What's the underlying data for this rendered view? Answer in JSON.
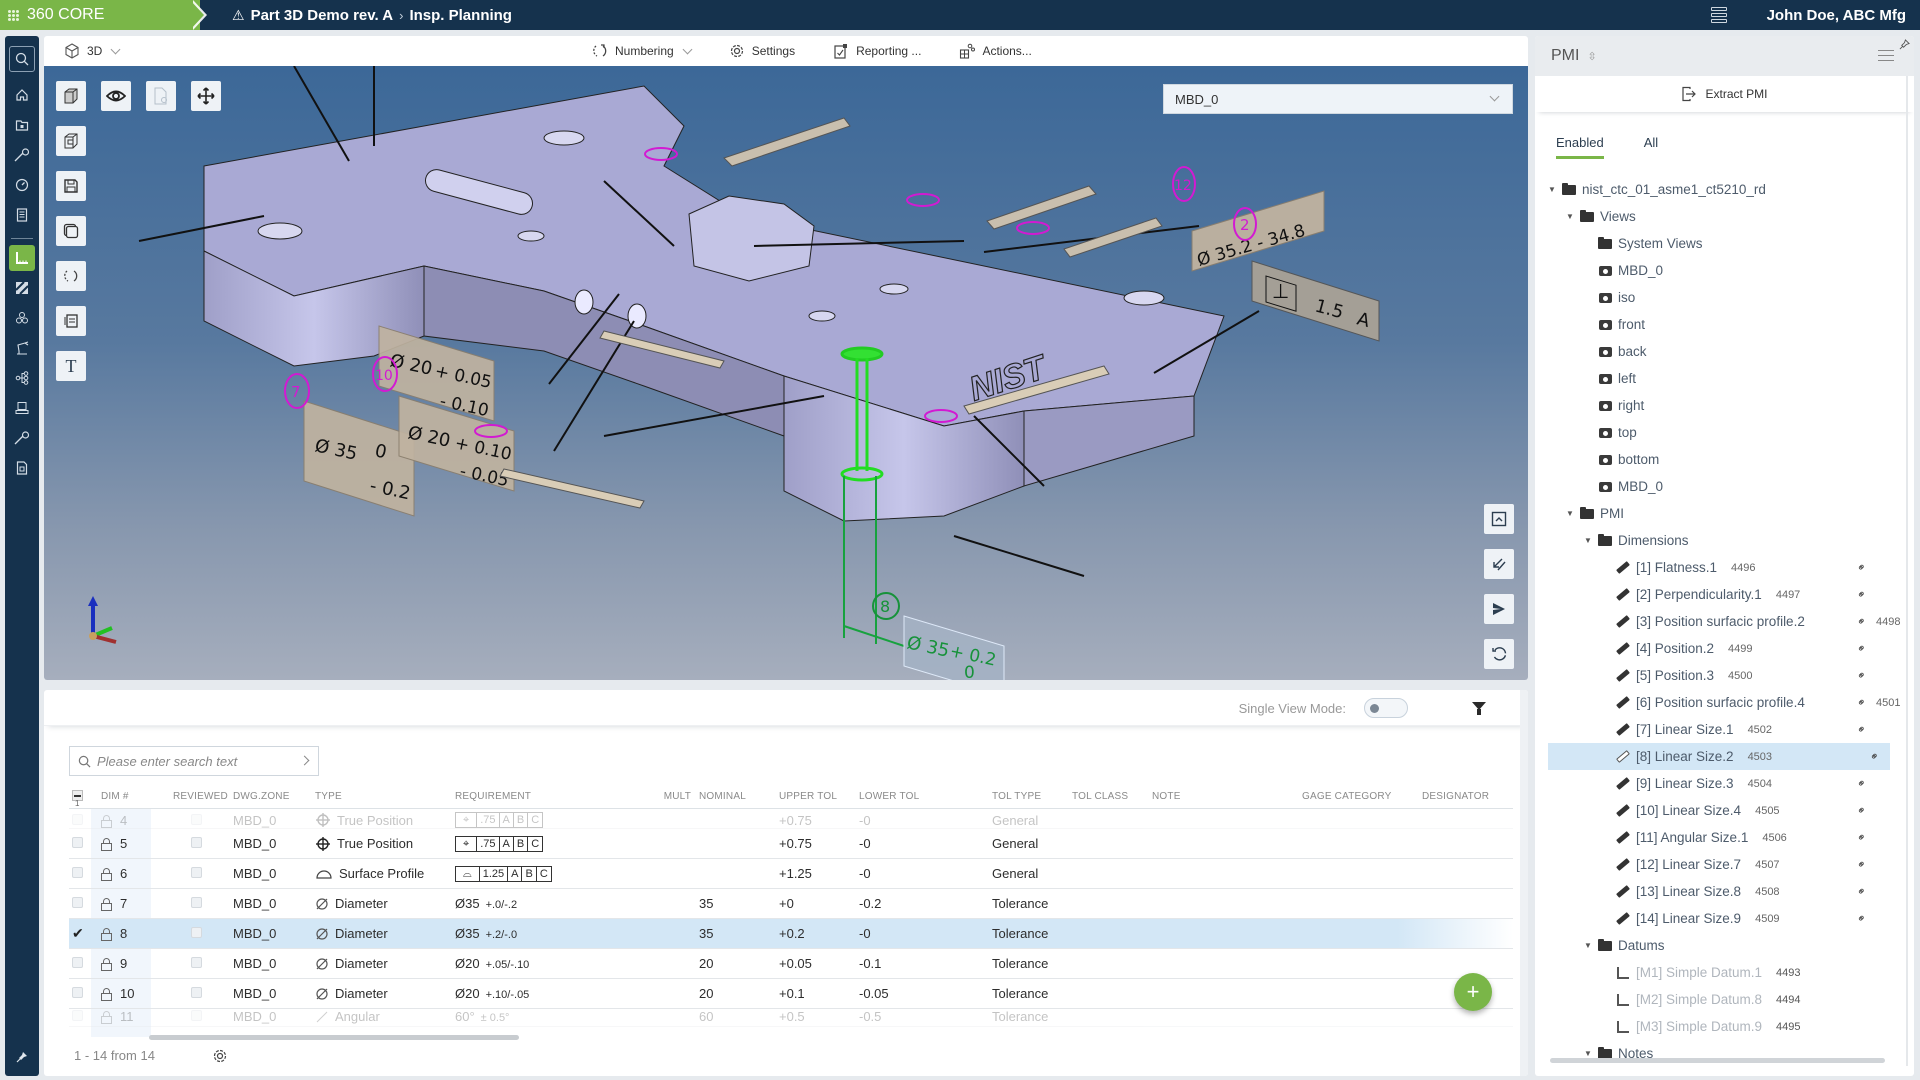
{
  "header": {
    "brand": "360 CORE",
    "part_title": "Part 3D Demo rev. A",
    "crumb_separator": "›",
    "section": "Insp. Planning",
    "user": "John Doe, ABC Mfg",
    "brand_color": "#7ab648",
    "bar_color": "#15324d"
  },
  "rail": {
    "items": [
      {
        "name": "search",
        "icon": "search-icon"
      },
      {
        "name": "home",
        "icon": "home-icon"
      },
      {
        "name": "parts-folder",
        "icon": "folder-icon"
      },
      {
        "name": "measure",
        "icon": "caliper-icon"
      },
      {
        "name": "dashboard",
        "icon": "gauge-icon"
      },
      {
        "name": "documents",
        "icon": "document-icon"
      },
      {
        "name": "inspection-planning",
        "icon": "ruler-icon",
        "active": true
      },
      {
        "name": "materials",
        "icon": "hatch-icon"
      },
      {
        "name": "resources",
        "icon": "cluster-icon"
      },
      {
        "name": "robot",
        "icon": "robot-arm-icon"
      },
      {
        "name": "workflow",
        "icon": "network-icon"
      },
      {
        "name": "machines",
        "icon": "machine-icon"
      },
      {
        "name": "gauges",
        "icon": "caliper-icon"
      },
      {
        "name": "reports",
        "icon": "report-icon"
      }
    ]
  },
  "viewer": {
    "mode_label": "3D",
    "toolbar": {
      "numbering": "Numbering",
      "settings": "Settings",
      "reporting": "Reporting ...",
      "actions": "Actions..."
    },
    "view_select": "MBD_0",
    "annotations": {
      "dim7_a": "Ø 35",
      "dim7_b": "0",
      "dim7_c": "- 0.2",
      "dim10_a": "Ø 20",
      "dim10_b": "+ 0.05",
      "dim10_c": "- 0.10",
      "dim9_a": "Ø 20",
      "dim9_b": "+ 0.10",
      "dim9_c": "- 0.05",
      "dim12": "Ø 35.2 - 34.8",
      "perp_val": "1.5",
      "perp_datum": "A",
      "dim8_a": "Ø 35",
      "dim8_b": "+ 0.2",
      "dim8_c": "0",
      "balloon_7": "7",
      "balloon_10": "10",
      "balloon_12": "12",
      "balloon_2": "2",
      "balloon_8": "8",
      "logo": "NIST"
    }
  },
  "table": {
    "single_view_label": "Single View Mode:",
    "single_view_on": false,
    "search_placeholder": "Please enter search text",
    "select_all_count": "1",
    "columns": [
      "DIM #",
      "REVIEWED",
      "DWG.ZONE",
      "TYPE",
      "REQUIREMENT",
      "MULT",
      "NOMINAL",
      "UPPER TOL",
      "LOWER TOL",
      "TOL TYPE",
      "TOL CLASS",
      "NOTE",
      "GAGE CATEGORY",
      "DESIGNATOR"
    ],
    "rows": [
      {
        "dim": "4",
        "zone": "MBD_0",
        "type": "True Position",
        "type_icon": "position-icon",
        "req_fcf": [
          "⌖",
          ".75",
          "A",
          "B",
          "C"
        ],
        "req": "",
        "req_tol": "",
        "mult": "",
        "nominal": "",
        "upper": "+0.75",
        "lower": "-0",
        "tol_type": "General",
        "checked": false,
        "faded": "top"
      },
      {
        "dim": "5",
        "zone": "MBD_0",
        "type": "True Position",
        "type_icon": "position-icon",
        "req_fcf": [
          "⌖",
          ".75",
          "A",
          "B",
          "C"
        ],
        "req": "",
        "req_tol": "",
        "mult": "",
        "nominal": "",
        "upper": "+0.75",
        "lower": "-0",
        "tol_type": "General",
        "checked": false
      },
      {
        "dim": "6",
        "zone": "MBD_0",
        "type": "Surface Profile",
        "type_icon": "surface-profile-icon",
        "req_fcf": [
          "⌓",
          "1.25",
          "A",
          "B",
          "C"
        ],
        "req": "",
        "req_tol": "",
        "mult": "",
        "nominal": "",
        "upper": "+1.25",
        "lower": "-0",
        "tol_type": "General",
        "checked": false
      },
      {
        "dim": "7",
        "zone": "MBD_0",
        "type": "Diameter",
        "type_icon": "diameter-icon",
        "req_fcf": null,
        "req": "Ø35",
        "req_tol": "+.0/-.2",
        "mult": "",
        "nominal": "35",
        "upper": "+0",
        "lower": "-0.2",
        "tol_type": "Tolerance",
        "checked": false
      },
      {
        "dim": "8",
        "zone": "MBD_0",
        "type": "Diameter",
        "type_icon": "diameter-icon",
        "req_fcf": null,
        "req": "Ø35",
        "req_tol": "+.2/-.0",
        "mult": "",
        "nominal": "35",
        "upper": "+0.2",
        "lower": "-0",
        "tol_type": "Tolerance",
        "checked": true,
        "selected": true
      },
      {
        "dim": "9",
        "zone": "MBD_0",
        "type": "Diameter",
        "type_icon": "diameter-icon",
        "req_fcf": null,
        "req": "Ø20",
        "req_tol": "+.05/-.10",
        "mult": "",
        "nominal": "20",
        "upper": "+0.05",
        "lower": "-0.1",
        "tol_type": "Tolerance",
        "checked": false
      },
      {
        "dim": "10",
        "zone": "MBD_0",
        "type": "Diameter",
        "type_icon": "diameter-icon",
        "req_fcf": null,
        "req": "Ø20",
        "req_tol": "+.10/-.05",
        "mult": "",
        "nominal": "20",
        "upper": "+0.1",
        "lower": "-0.05",
        "tol_type": "Tolerance",
        "checked": false
      },
      {
        "dim": "11",
        "zone": "MBD_0",
        "type": "Angular",
        "type_icon": "angle-icon",
        "req_fcf": null,
        "req": "60°",
        "req_tol": "± 0.5°",
        "mult": "",
        "nominal": "60",
        "upper": "+0.5",
        "lower": "-0.5",
        "tol_type": "Tolerance",
        "checked": false,
        "faded": "bottom"
      }
    ],
    "footer_count": "1 - 14 from 14",
    "add_button": "+"
  },
  "pmi": {
    "title": "PMI",
    "extract_label": "Extract PMI",
    "tabs": [
      {
        "label": "Enabled",
        "active": true
      },
      {
        "label": "All",
        "active": false
      }
    ],
    "tree": [
      {
        "level": 0,
        "label": "nist_ctc_01_asme1_ct5210_rd",
        "icon": "part",
        "expanded": true
      },
      {
        "level": 1,
        "label": "Views",
        "icon": "views",
        "expanded": true
      },
      {
        "level": 2,
        "label": "System Views",
        "icon": "folder"
      },
      {
        "level": 2,
        "label": "MBD_0",
        "icon": "camera"
      },
      {
        "level": 2,
        "label": "iso",
        "icon": "camera"
      },
      {
        "level": 2,
        "label": "front",
        "icon": "camera"
      },
      {
        "level": 2,
        "label": "back",
        "icon": "camera"
      },
      {
        "level": 2,
        "label": "left",
        "icon": "camera"
      },
      {
        "level": 2,
        "label": "right",
        "icon": "camera"
      },
      {
        "level": 2,
        "label": "top",
        "icon": "camera"
      },
      {
        "level": 2,
        "label": "bottom",
        "icon": "camera"
      },
      {
        "level": 2,
        "label": "MBD_0",
        "icon": "camera"
      },
      {
        "level": 1,
        "label": "PMI",
        "icon": "folder",
        "expanded": true
      },
      {
        "level": 2,
        "label": "Dimensions",
        "icon": "folder",
        "expanded": true
      },
      {
        "level": 3,
        "label": "[1] Flatness.1",
        "num": "4496",
        "icon": "ruler",
        "link": true
      },
      {
        "level": 3,
        "label": "[2] Perpendicularity.1",
        "num": "4497",
        "icon": "ruler",
        "link": true
      },
      {
        "level": 3,
        "label": "[3] Position surfacic profile.2",
        "num": "4498",
        "icon": "ruler",
        "link": true,
        "overflow": true
      },
      {
        "level": 3,
        "label": "[4] Position.2",
        "num": "4499",
        "icon": "ruler",
        "link": true
      },
      {
        "level": 3,
        "label": "[5] Position.3",
        "num": "4500",
        "icon": "ruler",
        "link": true
      },
      {
        "level": 3,
        "label": "[6] Position surfacic profile.4",
        "num": "4501",
        "icon": "ruler",
        "link": true,
        "overflow": true
      },
      {
        "level": 3,
        "label": "[7] Linear Size.1",
        "num": "4502",
        "icon": "ruler",
        "link": true
      },
      {
        "level": 3,
        "label": "[8] Linear Size.2",
        "num": "4503",
        "icon": "ruler",
        "link": true,
        "selected": true
      },
      {
        "level": 3,
        "label": "[9] Linear Size.3",
        "num": "4504",
        "icon": "ruler",
        "link": true
      },
      {
        "level": 3,
        "label": "[10] Linear Size.4",
        "num": "4505",
        "icon": "ruler",
        "link": true
      },
      {
        "level": 3,
        "label": "[11] Angular Size.1",
        "num": "4506",
        "icon": "ruler",
        "link": true
      },
      {
        "level": 3,
        "label": "[12] Linear Size.7",
        "num": "4507",
        "icon": "ruler",
        "link": true
      },
      {
        "level": 3,
        "label": "[13] Linear Size.8",
        "num": "4508",
        "icon": "ruler",
        "link": true
      },
      {
        "level": 3,
        "label": "[14] Linear Size.9",
        "num": "4509",
        "icon": "ruler",
        "link": true
      },
      {
        "level": 2,
        "label": "Datums",
        "icon": "folder",
        "expanded": true
      },
      {
        "level": 3,
        "label": "[M1] Simple Datum.1",
        "num": "4493",
        "icon": "datum",
        "datum": true
      },
      {
        "level": 3,
        "label": "[M2] Simple Datum.8",
        "num": "4494",
        "icon": "datum",
        "datum": true
      },
      {
        "level": 3,
        "label": "[M3] Simple Datum.9",
        "num": "4495",
        "icon": "datum",
        "datum": true
      },
      {
        "level": 2,
        "label": "Notes",
        "icon": "folder",
        "expanded": true
      }
    ]
  }
}
